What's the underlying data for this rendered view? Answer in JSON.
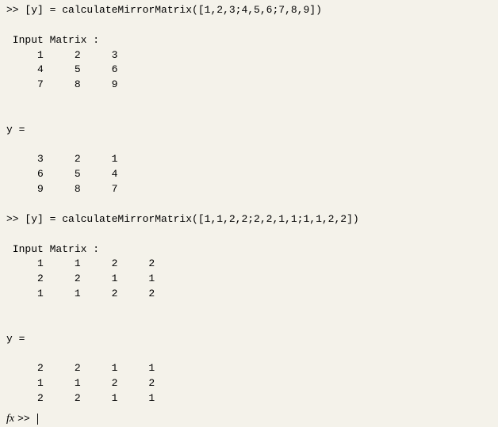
{
  "block1": {
    "cmd": ">> [y] = calculateMirrorMatrix([1,2,3;4,5,6;7,8,9])",
    "inputLabel": " Input Matrix :",
    "inputRows": [
      "     1     2     3",
      "     4     5     6",
      "     7     8     9"
    ],
    "outLabel": "y =",
    "outRows": [
      "     3     2     1",
      "     6     5     4",
      "     9     8     7"
    ]
  },
  "block2": {
    "cmd": ">> [y] = calculateMirrorMatrix([1,1,2,2;2,2,1,1;1,1,2,2])",
    "inputLabel": " Input Matrix :",
    "inputRows": [
      "     1     1     2     2",
      "     2     2     1     1",
      "     1     1     2     2"
    ],
    "outLabel": "y =",
    "outRows": [
      "     2     2     1     1",
      "     1     1     2     2",
      "     2     2     1     1"
    ]
  },
  "prompt": {
    "fx": "fx",
    "text": ">> "
  }
}
